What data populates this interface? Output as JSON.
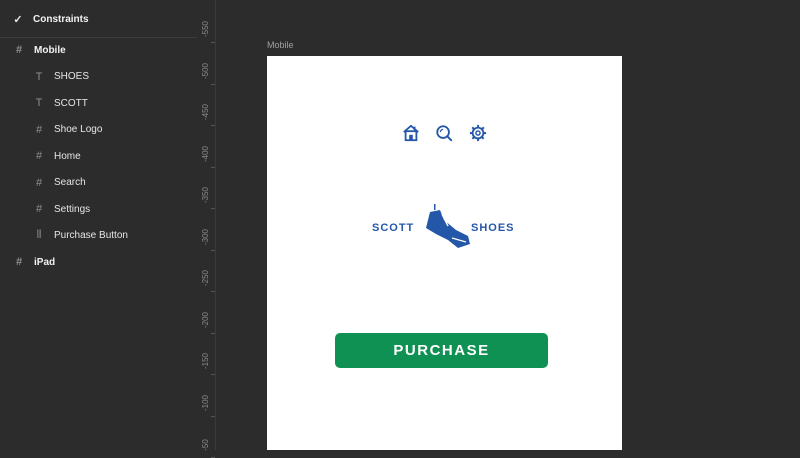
{
  "layers": {
    "constraints_label": "Constraints",
    "items": [
      {
        "label": "Mobile",
        "type": "frame",
        "level": 0
      },
      {
        "label": "SHOES",
        "type": "text",
        "level": 1
      },
      {
        "label": "SCOTT",
        "type": "text",
        "level": 1
      },
      {
        "label": "Shoe Logo",
        "type": "frame",
        "level": 1
      },
      {
        "label": "Home",
        "type": "frame",
        "level": 1
      },
      {
        "label": "Search",
        "type": "frame",
        "level": 1
      },
      {
        "label": "Settings",
        "type": "frame",
        "level": 1
      },
      {
        "label": "Purchase Button",
        "type": "component",
        "level": 1
      },
      {
        "label": "iPad",
        "type": "frame",
        "level": 0
      }
    ]
  },
  "ruler": {
    "ticks": [
      "-550",
      "-500",
      "-450",
      "-400",
      "-350",
      "-300",
      "-250",
      "-200",
      "-150",
      "-100",
      "-50"
    ]
  },
  "canvas": {
    "frame_label": "Mobile",
    "logo_left": "SCOTT",
    "logo_right": "SHOES",
    "purchase_label": "PURCHASE",
    "colors": {
      "brand_blue": "#2557a8",
      "purchase_green": "#0e9152"
    }
  }
}
